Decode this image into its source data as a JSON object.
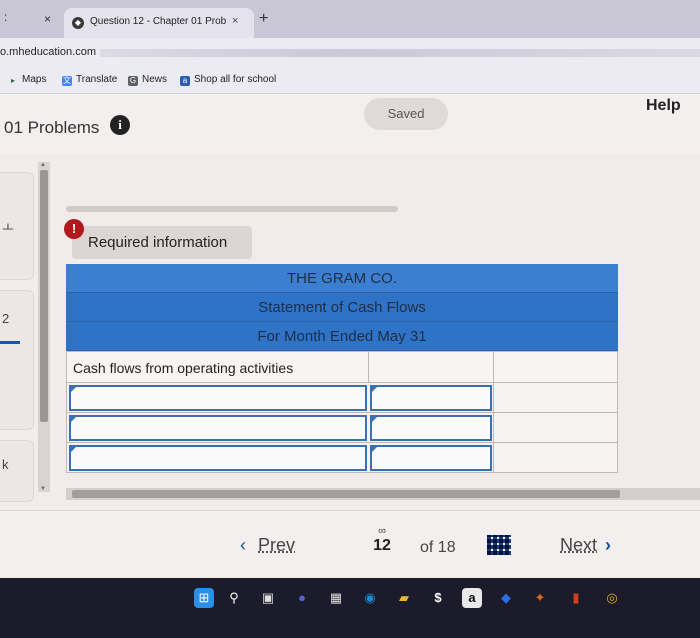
{
  "browser": {
    "menu_dots": ":",
    "prev_tab_close": "×",
    "tab": {
      "title": "Question 12 - Chapter 01 Prob",
      "close": "×"
    },
    "new_tab": "+",
    "url": "o.mheducation.com",
    "bookmarks": [
      {
        "label": "Maps",
        "icon": "map-pin-icon",
        "color": "#2c6e49"
      },
      {
        "label": "Translate",
        "icon": "translate-icon",
        "color": "#4285f4"
      },
      {
        "label": "News",
        "icon": "news-icon",
        "color": "#5f6368"
      },
      {
        "label": "Shop all for school",
        "icon": "amazon-icon",
        "color": "#2a5db0"
      }
    ]
  },
  "header": {
    "title": "01 Problems",
    "info_glyph": "i",
    "saved": "Saved",
    "help": "Help"
  },
  "left_panel": {
    "items": [
      "ㅗ",
      "2",
      "k"
    ]
  },
  "question": {
    "alert_glyph": "!",
    "required_info": "Required information",
    "statement": {
      "company": "THE GRAM CO.",
      "title": "Statement of Cash Flows",
      "period": "For Month Ended May 31",
      "section": "Cash flows from operating activities",
      "input_rows": 3
    }
  },
  "nav": {
    "prev": "Prev",
    "prev_chevron": "‹",
    "link_glyph": "∞",
    "page": "12",
    "of": "of 18",
    "next": "Next",
    "next_chevron": "›"
  },
  "colors": {
    "header_blue": "#2f73c6",
    "link_blue": "#1a4f97",
    "alert_red": "#b1191c"
  },
  "taskbar": {
    "icons": [
      {
        "name": "windows-start-icon",
        "glyph": "⊞",
        "color": "#2b8fe6"
      },
      {
        "name": "search-icon",
        "glyph": "⚲",
        "color": "#1c1b2b"
      },
      {
        "name": "task-view-icon",
        "glyph": "▣",
        "color": "#1c1b2b"
      },
      {
        "name": "chat-icon",
        "glyph": "●",
        "color": "#5a5fd6"
      },
      {
        "name": "calendar-icon",
        "glyph": "▦",
        "color": "#1c1b2b"
      },
      {
        "name": "edge-icon",
        "glyph": "◉",
        "color": "#1a8ad4"
      },
      {
        "name": "folder-icon",
        "glyph": "▰",
        "color": "#e8b830"
      },
      {
        "name": "dollar-icon",
        "glyph": "$",
        "color": "#1c1b2b"
      },
      {
        "name": "amazon-icon",
        "glyph": "a",
        "color": "#e8e8e8"
      },
      {
        "name": "dropbox-icon",
        "glyph": "◆",
        "color": "#1c1b2b"
      },
      {
        "name": "bird-icon",
        "glyph": "✦",
        "color": "#d86a18"
      },
      {
        "name": "office-icon",
        "glyph": "▮",
        "color": "#d83b1c"
      },
      {
        "name": "chrome-icon",
        "glyph": "◎",
        "color": "#e7a920"
      }
    ]
  }
}
